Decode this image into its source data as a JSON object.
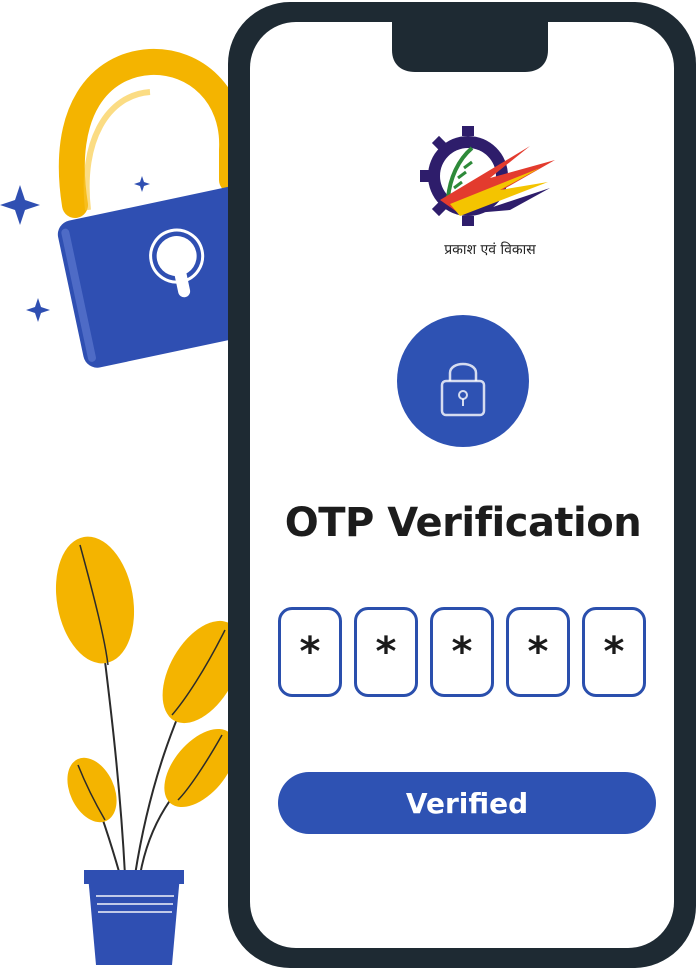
{
  "brand": {
    "logo_caption": "प्रकाश एवं विकास"
  },
  "screen": {
    "title": "OTP Verification",
    "otp_digits": [
      "*",
      "*",
      "*",
      "*",
      "*"
    ],
    "button_label": "Verified"
  },
  "colors": {
    "primary": "#2e52b3",
    "phone_frame": "#1e2a33",
    "accent_yellow": "#f4b400",
    "lock_blue": "#2f4fb2"
  },
  "icons": [
    "padlock-icon",
    "lock-circle-icon",
    "sparkle-icon",
    "plant-illustration",
    "company-logo"
  ]
}
